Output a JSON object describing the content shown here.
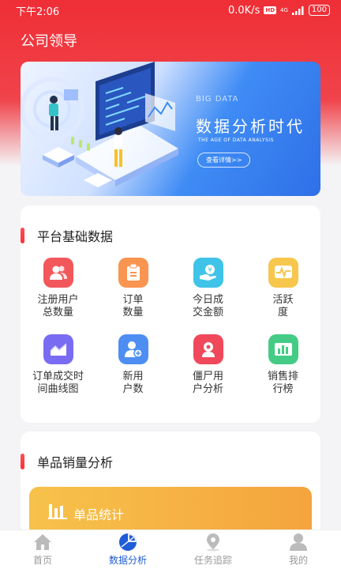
{
  "status_bar": {
    "time": "下午2:06",
    "speed": "0.0K/s",
    "hd": "HD",
    "network": "4G",
    "battery": "100"
  },
  "header": {
    "title": "公司领导"
  },
  "banner": {
    "big_data": "BIG DATA",
    "title": "数据分析时代",
    "subtitle": "THE AGE OF DATA ANALYSIS",
    "button": "查看详情>>"
  },
  "platform": {
    "title": "平台基础数据",
    "items": [
      {
        "label": "注册用户\n总数量",
        "icon": "users-icon",
        "color": "#f2585b"
      },
      {
        "label": "订单\n数量",
        "icon": "clipboard-icon",
        "color": "#f99550"
      },
      {
        "label": "今日成\n交金额",
        "icon": "hand-coin-icon",
        "color": "#3fc3e8"
      },
      {
        "label": "活跃\n度",
        "icon": "pulse-icon",
        "color": "#f7c64c"
      },
      {
        "label": "订单成交时\n间曲线图",
        "icon": "line-chart-icon",
        "color": "#7a6cf2"
      },
      {
        "label": "新用\n户数",
        "icon": "user-add-icon",
        "color": "#4e8ef3"
      },
      {
        "label": "僵尸用\n户分析",
        "icon": "zombie-icon",
        "color": "#f0495b"
      },
      {
        "label": "销售排\n行榜",
        "icon": "bar-chart-icon",
        "color": "#44cc86"
      }
    ]
  },
  "product": {
    "title": "单品销量分析",
    "stat_label": "单品统计"
  },
  "tabbar": {
    "items": [
      {
        "label": "首页",
        "icon": "home-icon"
      },
      {
        "label": "数据分析",
        "icon": "pie-chart-icon"
      },
      {
        "label": "任务追踪",
        "icon": "location-icon"
      },
      {
        "label": "我的",
        "icon": "person-icon"
      }
    ]
  }
}
